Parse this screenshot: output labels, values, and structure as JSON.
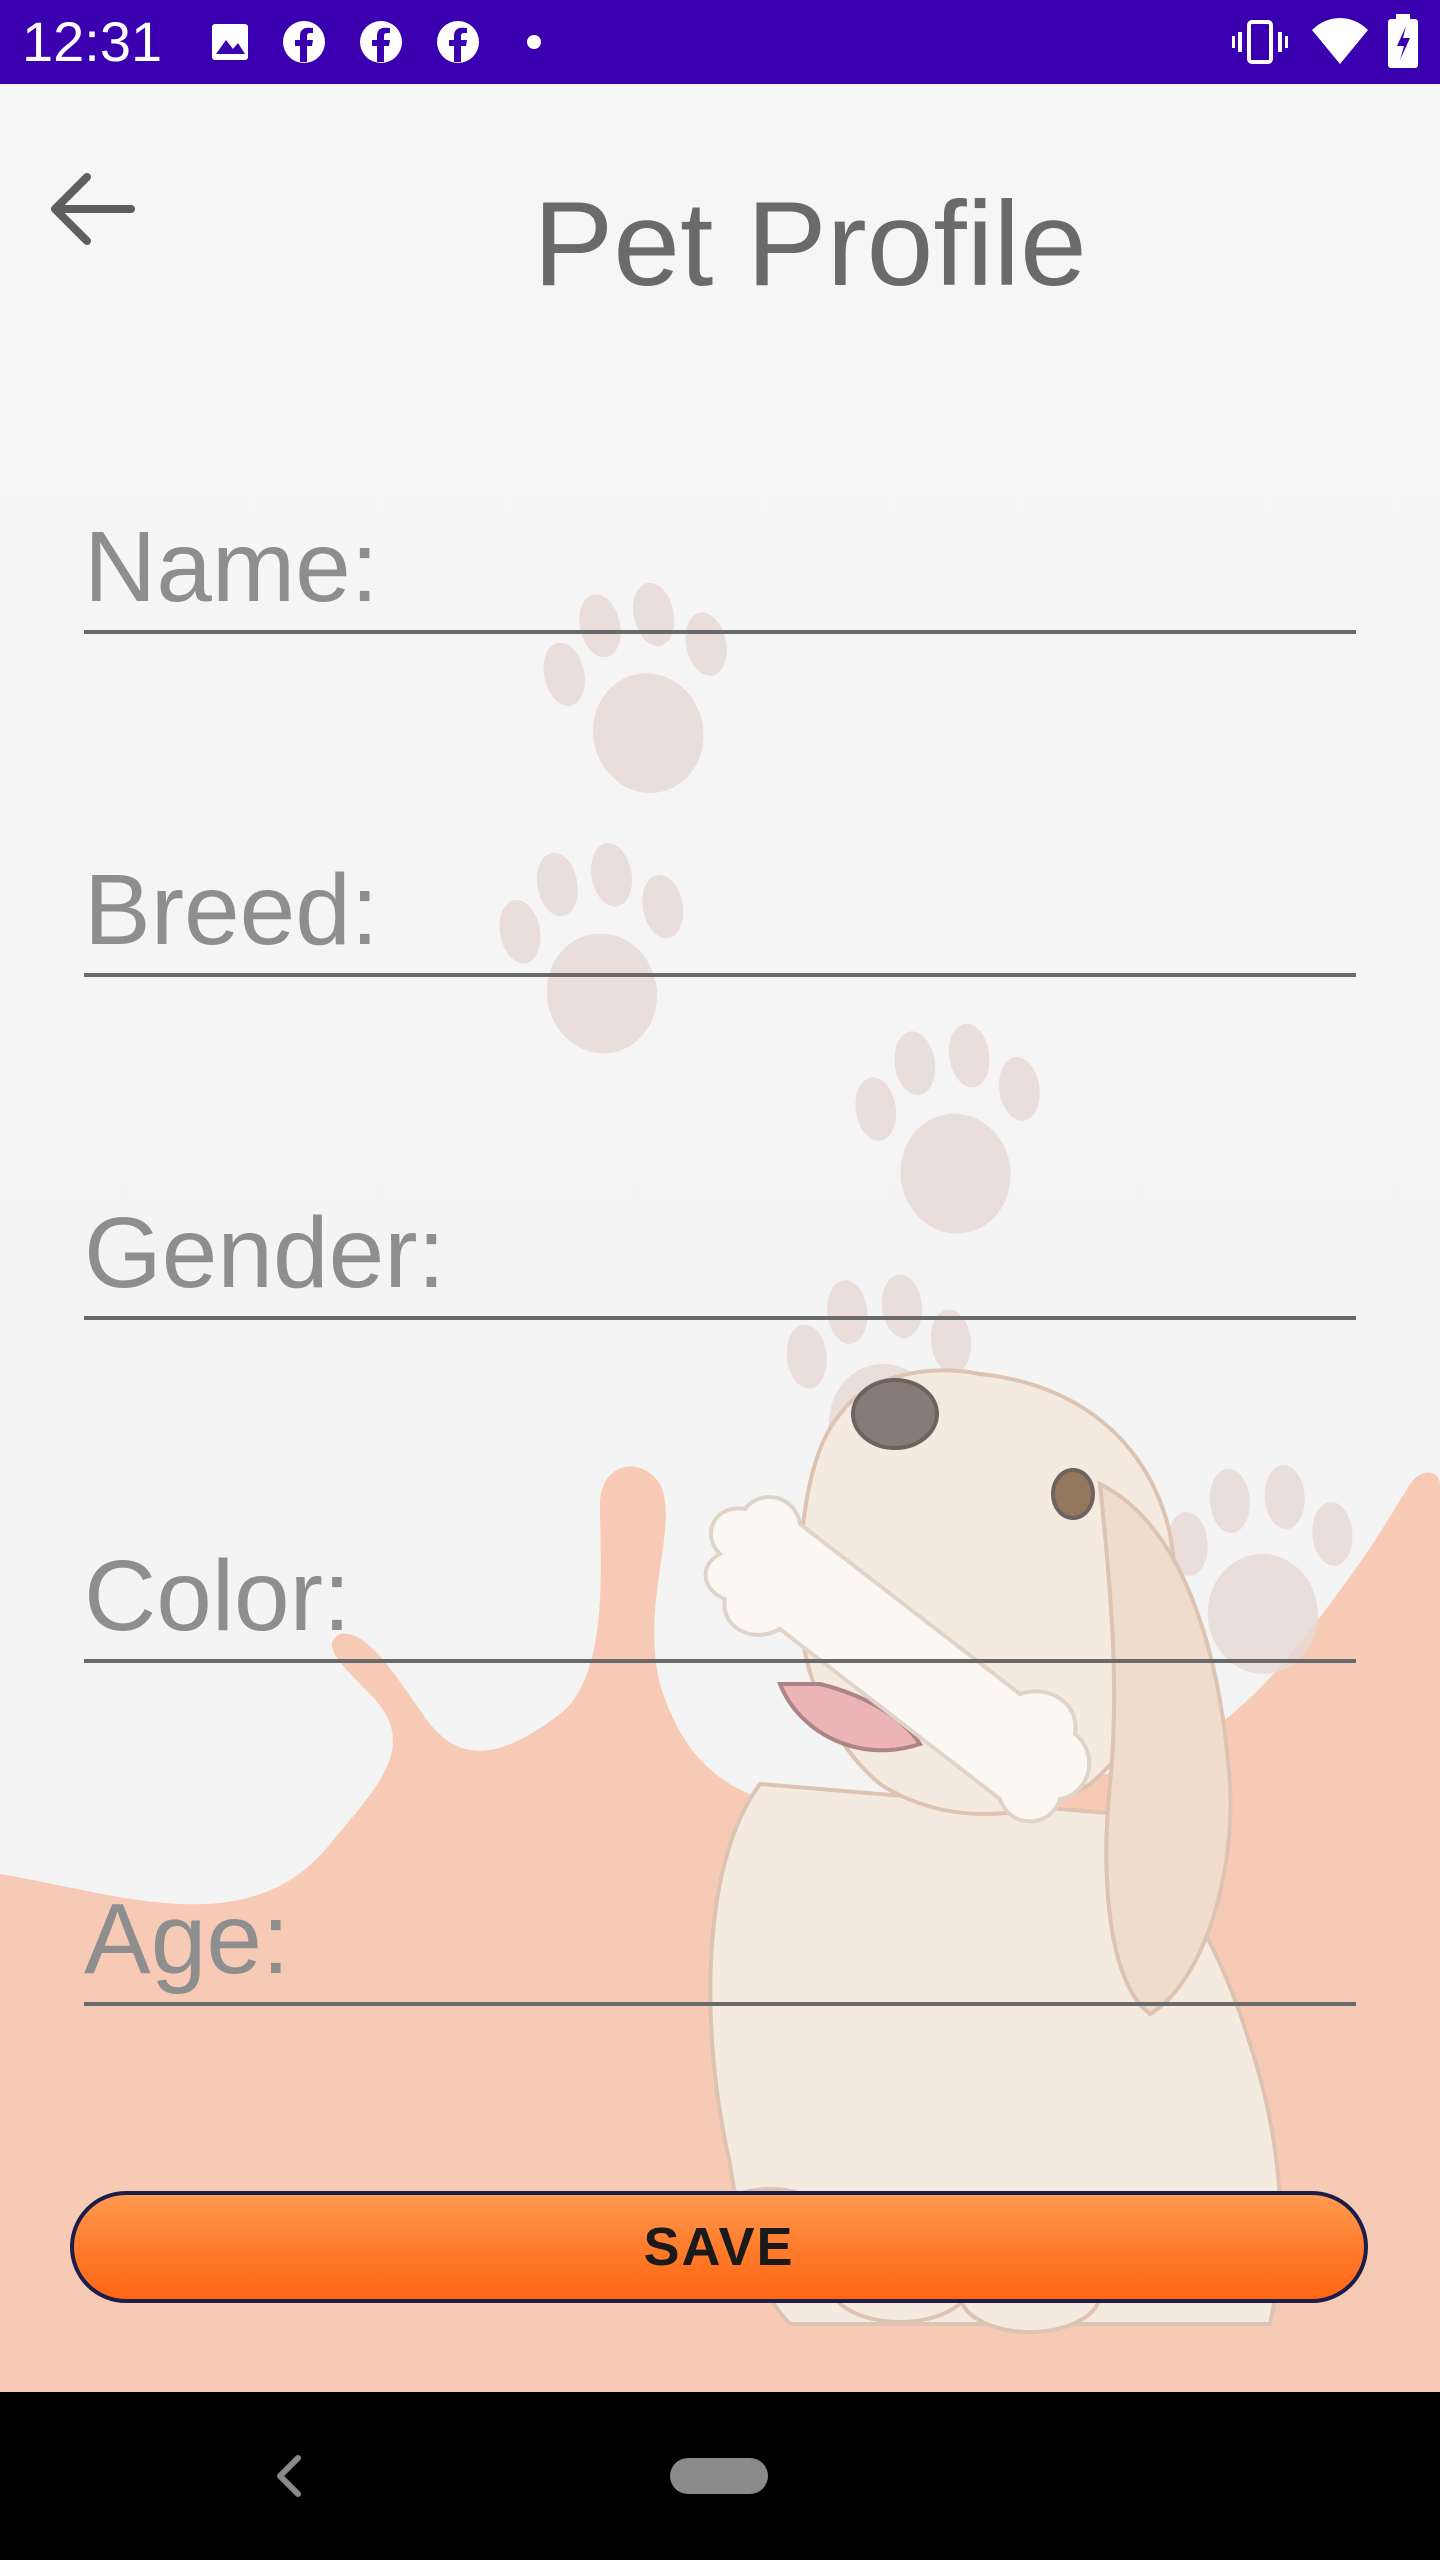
{
  "status_bar": {
    "time": "12:31",
    "left_icons": [
      "image-icon",
      "facebook-icon",
      "facebook-icon",
      "facebook-icon",
      "dot-icon"
    ],
    "right_icons": [
      "vibrate-icon",
      "wifi-icon",
      "battery-icon"
    ],
    "background": "#3a00b0"
  },
  "header": {
    "title": "Pet Profile",
    "back_icon": "arrow-left-icon"
  },
  "form": {
    "name_placeholder": "Name:",
    "breed_placeholder": "Breed:",
    "gender_placeholder": "Gender:",
    "color_placeholder": "Color:",
    "age_placeholder": "Age:"
  },
  "save_label": "SAVE",
  "colors": {
    "accent": "#ff7a2a",
    "background": "#f3f3f3",
    "splash": "#f6bfa7",
    "text_muted": "#6a6a6a"
  },
  "nav_bar": {
    "back_icon": "chevron-left-icon",
    "home_icon": "home-pill-icon"
  }
}
